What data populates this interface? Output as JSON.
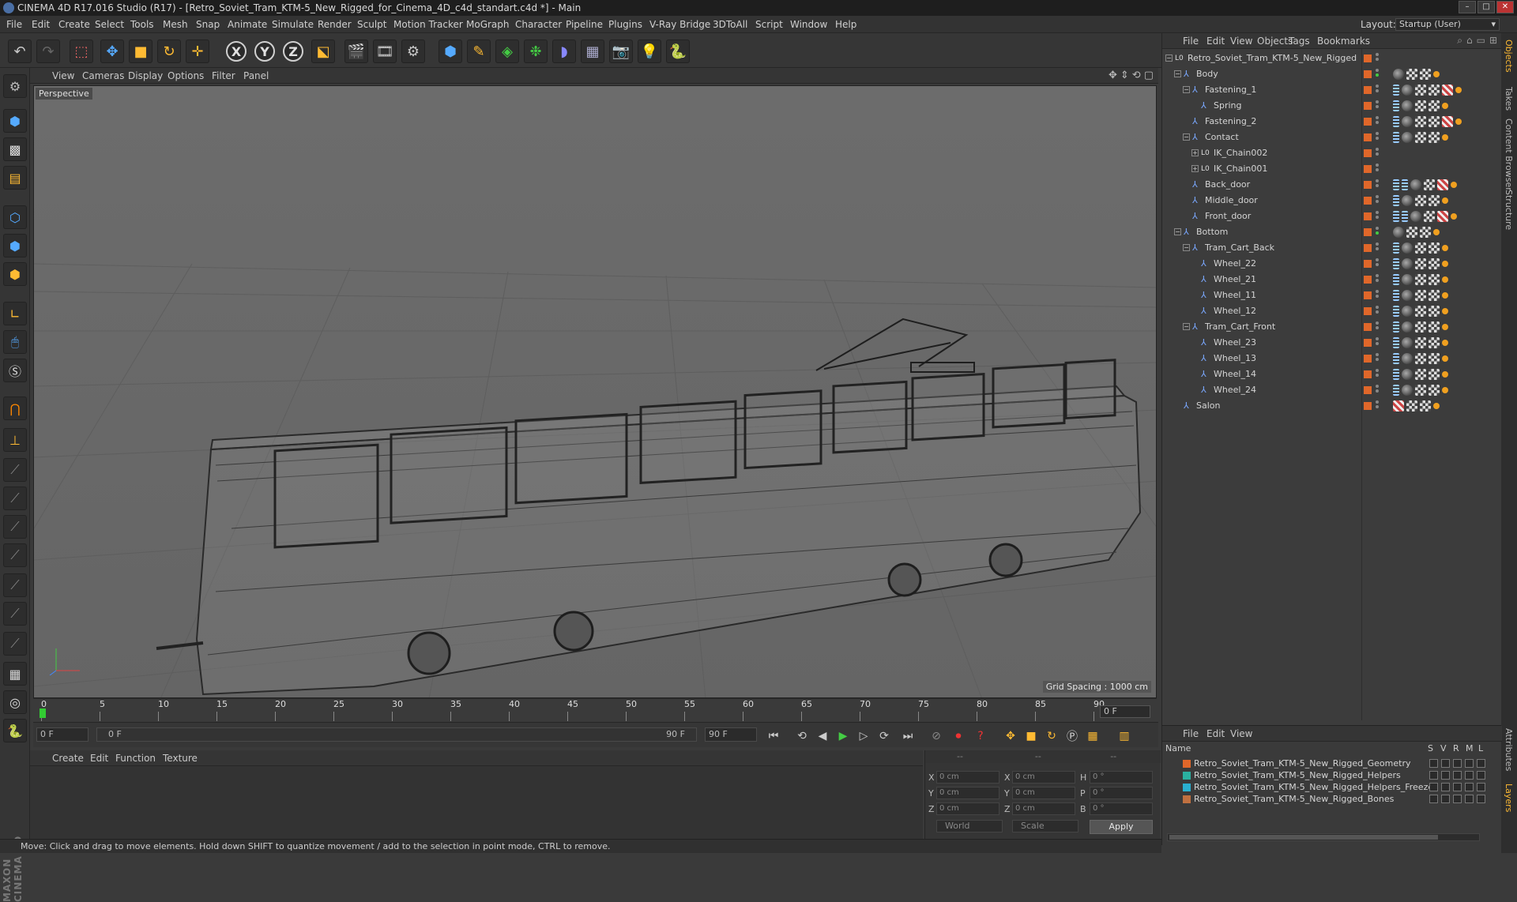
{
  "window": {
    "title": "CINEMA 4D R17.016 Studio (R17) - [Retro_Soviet_Tram_KTM-5_New_Rigged_for_Cinema_4D_c4d_standart.c4d *] - Main"
  },
  "menubar": {
    "items": [
      "File",
      "Edit",
      "Create",
      "Select",
      "Tools",
      "Mesh",
      "Snap",
      "Animate",
      "Simulate",
      "Render",
      "Sculpt",
      "Motion Tracker",
      "MoGraph",
      "Character",
      "Pipeline",
      "Plugins",
      "V-Ray Bridge",
      "3DToAll",
      "Script",
      "Window",
      "Help"
    ],
    "layout_label": "Layout:",
    "layout_value": "Startup (User)"
  },
  "toolbar": {
    "axis_x": "X",
    "axis_y": "Y",
    "axis_z": "Z"
  },
  "viewport": {
    "menu": [
      "View",
      "Cameras",
      "Display",
      "Options",
      "Filter",
      "Panel"
    ],
    "camera_label": "Perspective",
    "grid_spacing": "Grid Spacing : 1000 cm"
  },
  "timeline": {
    "ticks": [
      "0",
      "5",
      "10",
      "15",
      "20",
      "25",
      "30",
      "35",
      "40",
      "45",
      "50",
      "55",
      "60",
      "65",
      "70",
      "75",
      "80",
      "85",
      "90"
    ],
    "current_frame": "0 F",
    "start_field": "0 F",
    "range_start": "0 F",
    "range_end": "90 F",
    "end_field": "90 F"
  },
  "material_manager": {
    "menu": [
      "Create",
      "Edit",
      "Function",
      "Texture"
    ]
  },
  "coordinates": {
    "rows": [
      {
        "a": "X",
        "av": "0 cm",
        "b": "X",
        "bv": "0 cm",
        "c": "H",
        "cv": "0 °"
      },
      {
        "a": "Y",
        "av": "0 cm",
        "b": "Y",
        "bv": "0 cm",
        "c": "P",
        "cv": "0 °"
      },
      {
        "a": "Z",
        "av": "0 cm",
        "b": "Z",
        "bv": "0 cm",
        "c": "B",
        "cv": "0 °"
      }
    ],
    "space": "World",
    "mode": "Scale",
    "apply": "Apply"
  },
  "object_manager": {
    "menu": [
      "File",
      "Edit",
      "View",
      "Objects",
      "Tags",
      "Bookmarks"
    ],
    "objects": [
      {
        "name": "Retro_Soviet_Tram_KTM-5_New_Rigged",
        "depth": 0,
        "icon": "null",
        "tags": []
      },
      {
        "name": "Body",
        "depth": 1,
        "icon": "joint",
        "tags": [
          "sph",
          "chk",
          "chk",
          "dot"
        ]
      },
      {
        "name": "Fastening_1",
        "depth": 2,
        "icon": "joint",
        "tags": [
          "ik",
          "sph",
          "chk",
          "chk",
          "mix",
          "dot"
        ]
      },
      {
        "name": "Spring",
        "depth": 3,
        "icon": "joint",
        "tags": [
          "ik",
          "sph",
          "chk",
          "chk",
          "dot"
        ]
      },
      {
        "name": "Fastening_2",
        "depth": 2,
        "icon": "joint",
        "tags": [
          "ik",
          "sph",
          "chk",
          "chk",
          "mix",
          "dot"
        ]
      },
      {
        "name": "Contact",
        "depth": 2,
        "icon": "joint",
        "tags": [
          "ik",
          "sph",
          "chk",
          "chk",
          "dot"
        ]
      },
      {
        "name": "IK_Chain002",
        "depth": 3,
        "icon": "null",
        "tags": []
      },
      {
        "name": "IK_Chain001",
        "depth": 3,
        "icon": "null",
        "tags": []
      },
      {
        "name": "Back_door",
        "depth": 2,
        "icon": "joint",
        "tags": [
          "ik",
          "ik",
          "sph",
          "chk",
          "mix",
          "dot"
        ]
      },
      {
        "name": "Middle_door",
        "depth": 2,
        "icon": "joint",
        "tags": [
          "ik",
          "sph",
          "chk",
          "chk",
          "dot"
        ]
      },
      {
        "name": "Front_door",
        "depth": 2,
        "icon": "joint",
        "tags": [
          "ik",
          "ik",
          "sph",
          "chk",
          "mix",
          "dot"
        ]
      },
      {
        "name": "Bottom",
        "depth": 1,
        "icon": "joint",
        "tags": [
          "sph",
          "chk",
          "chk",
          "dot"
        ]
      },
      {
        "name": "Tram_Cart_Back",
        "depth": 2,
        "icon": "joint",
        "tags": [
          "ik",
          "sph",
          "chk",
          "chk",
          "dot"
        ]
      },
      {
        "name": "Wheel_22",
        "depth": 3,
        "icon": "joint",
        "tags": [
          "ik",
          "sph",
          "chk",
          "chk",
          "dot"
        ]
      },
      {
        "name": "Wheel_21",
        "depth": 3,
        "icon": "joint",
        "tags": [
          "ik",
          "sph",
          "chk",
          "chk",
          "dot"
        ]
      },
      {
        "name": "Wheel_11",
        "depth": 3,
        "icon": "joint",
        "tags": [
          "ik",
          "sph",
          "chk",
          "chk",
          "dot"
        ]
      },
      {
        "name": "Wheel_12",
        "depth": 3,
        "icon": "joint",
        "tags": [
          "ik",
          "sph",
          "chk",
          "chk",
          "dot"
        ]
      },
      {
        "name": "Tram_Cart_Front",
        "depth": 2,
        "icon": "joint",
        "tags": [
          "ik",
          "sph",
          "chk",
          "chk",
          "dot"
        ]
      },
      {
        "name": "Wheel_23",
        "depth": 3,
        "icon": "joint",
        "tags": [
          "ik",
          "sph",
          "chk",
          "chk",
          "dot"
        ]
      },
      {
        "name": "Wheel_13",
        "depth": 3,
        "icon": "joint",
        "tags": [
          "ik",
          "sph",
          "chk",
          "chk",
          "dot"
        ]
      },
      {
        "name": "Wheel_14",
        "depth": 3,
        "icon": "joint",
        "tags": [
          "ik",
          "sph",
          "chk",
          "chk",
          "dot"
        ]
      },
      {
        "name": "Wheel_24",
        "depth": 3,
        "icon": "joint",
        "tags": [
          "ik",
          "sph",
          "chk",
          "chk",
          "dot"
        ]
      },
      {
        "name": "Salon",
        "depth": 1,
        "icon": "joint",
        "tags": [
          "mix",
          "chk",
          "chk",
          "dot"
        ]
      }
    ]
  },
  "layer_manager": {
    "menu": [
      "File",
      "Edit",
      "View"
    ],
    "col_name": "Name",
    "col_flags": [
      "S",
      "V",
      "R",
      "M",
      "L"
    ],
    "layers": [
      {
        "name": "Retro_Soviet_Tram_KTM-5_New_Rigged_Geometry",
        "color": "#e0672a"
      },
      {
        "name": "Retro_Soviet_Tram_KTM-5_New_Rigged_Helpers",
        "color": "#2ab0a0"
      },
      {
        "name": "Retro_Soviet_Tram_KTM-5_New_Rigged_Helpers_Freeze",
        "color": "#2ab0d0"
      },
      {
        "name": "Retro_Soviet_Tram_KTM-5_New_Rigged_Bones",
        "color": "#c07040"
      }
    ]
  },
  "side_tabs": [
    "Objects",
    "Takes",
    "Content Browser",
    "Structure"
  ],
  "side_tabs_lower": [
    "Attributes",
    "Layers"
  ],
  "status": "Move: Click and drag to move elements. Hold down SHIFT to quantize movement / add to the selection in point mode, CTRL to remove.",
  "logo": "MAXON CINEMA 4D"
}
